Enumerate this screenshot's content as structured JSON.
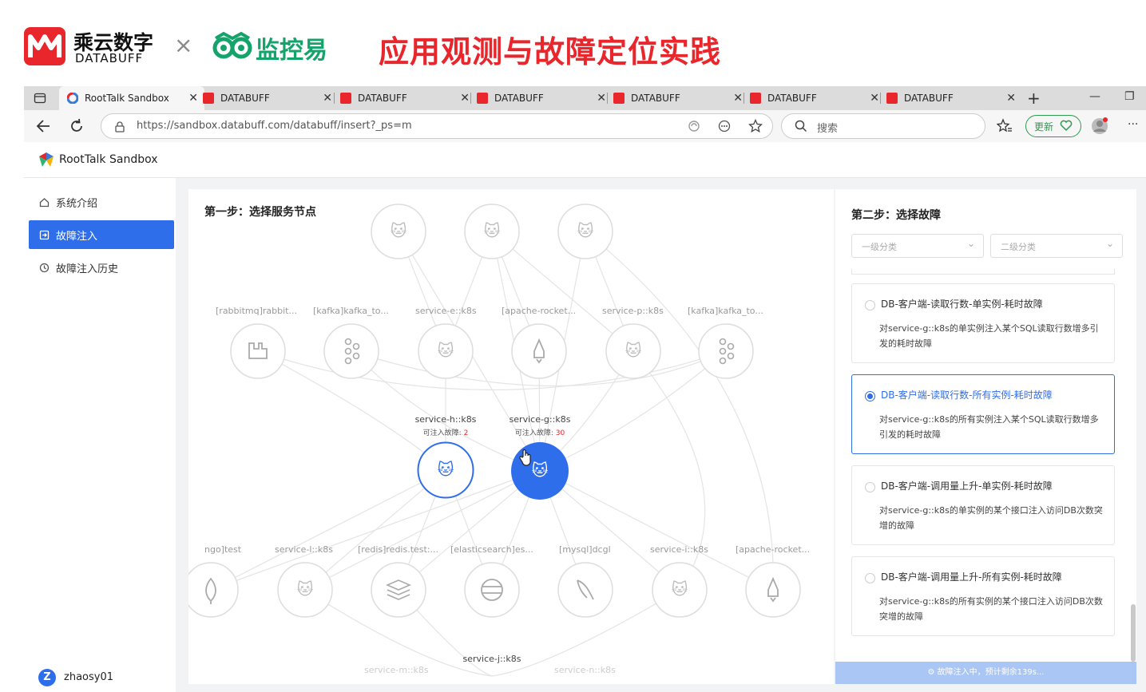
{
  "banner": {
    "brand_cn": "乘云数字",
    "brand_en": "DATABUFF",
    "times": "×",
    "partner": "监控易",
    "headline": "应用观测与故障定位实践"
  },
  "browser": {
    "tabs": [
      {
        "label": "RootTalk Sandbox",
        "active": true
      },
      {
        "label": "DATABUFF"
      },
      {
        "label": "DATABUFF"
      },
      {
        "label": "DATABUFF"
      },
      {
        "label": "DATABUFF"
      },
      {
        "label": "DATABUFF"
      },
      {
        "label": "DATABUFF"
      }
    ],
    "new_tab": "+",
    "minimize": "—",
    "restore": "❐",
    "url": "https://sandbox.databuff.com/databuff/insert?_ps=m",
    "search_placeholder": "搜索",
    "update_label": "更新",
    "more": "···"
  },
  "app": {
    "title": "RootTalk Sandbox",
    "nav": [
      {
        "label": "系统介绍",
        "icon": "home-icon"
      },
      {
        "label": "故障注入",
        "icon": "inject-icon",
        "active": true
      },
      {
        "label": "故障注入历史",
        "icon": "history-icon"
      }
    ],
    "user": {
      "initial": "Z",
      "name": "zhaosy01"
    }
  },
  "step1": {
    "title": "第一步：选择服务节点",
    "top_row_count": 3,
    "mid_labels": [
      "[rabbitmq]rabbit...",
      "[kafka]kafka_to...",
      "service-e::k8s",
      "[apache-rocket...",
      "service-p::k8s",
      "[kafka]kafka_to..."
    ],
    "center_nodes": [
      {
        "label": "service-h::k8s",
        "inject_label": "可注入故障:",
        "inject_count": "2"
      },
      {
        "label": "service-g::k8s",
        "inject_label": "可注入故障:",
        "inject_count": "30"
      }
    ],
    "bottom_labels": [
      "ngo]test",
      "service-l::k8s",
      "[redis]redis.test:...",
      "[elasticsearch]es...",
      "[mysql]dcgl",
      "service-i::k8s",
      "[apache-rocket..."
    ],
    "bottom_node": "service-j::k8s",
    "partial_labels": [
      "service-m::k8s",
      "service-n::k8s"
    ]
  },
  "step2": {
    "title": "第二步：选择故障",
    "select1": "一级分类",
    "select2": "二级分类",
    "cards": [
      {
        "title": "DB-客户端-读取行数-单实例-耗时故障",
        "desc": "对service-g::k8s的单实例注入某个SQL读取行数增多引发的耗时故障",
        "selected": false
      },
      {
        "title": "DB-客户端-读取行数-所有实例-耗时故障",
        "desc": "对service-g::k8s的所有实例注入某个SQL读取行数增多引发的耗时故障",
        "selected": true
      },
      {
        "title": "DB-客户端-调用量上升-单实例-耗时故障",
        "desc": "对service-g::k8s的单实例的某个接口注入访问DB次数突增的故障",
        "selected": false
      },
      {
        "title": "DB-客户端-调用量上升-所有实例-耗时故障",
        "desc": "对service-g::k8s的所有实例的某个接口注入访问DB次数突增的故障",
        "selected": false
      }
    ],
    "status": "故障注入中，预计剩余139s..."
  },
  "colors": {
    "brand_red": "#e8262c",
    "primary_blue": "#2f6eea",
    "partner_green": "#14a36b"
  }
}
